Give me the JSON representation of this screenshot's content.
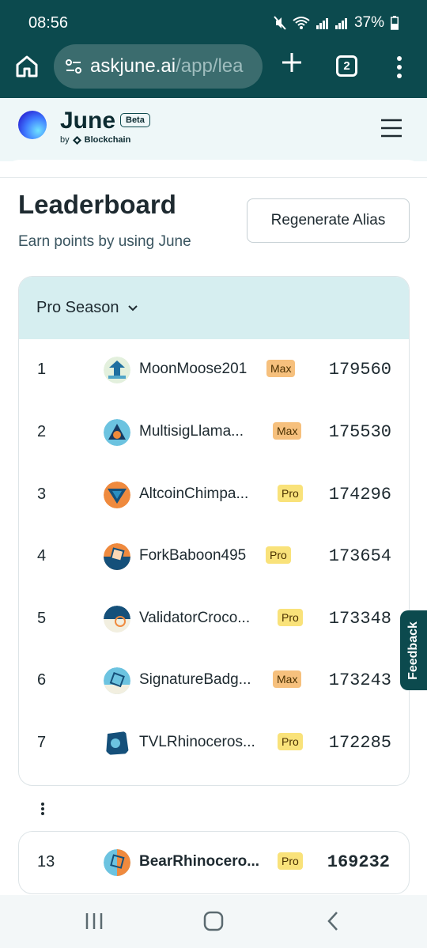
{
  "status_bar": {
    "time": "08:56",
    "battery": "37%"
  },
  "browser": {
    "url_host": "askjune.ai",
    "url_path": "/app/lea",
    "tab_count": "2"
  },
  "brand": {
    "name": "June",
    "badge": "Beta",
    "by_prefix": "by",
    "by_company": "Blockchain"
  },
  "page": {
    "title": "Leaderboard",
    "subtitle": "Earn points by using June",
    "regenerate_label": "Regenerate Alias",
    "season_label": "Pro Season"
  },
  "leaderboard": [
    {
      "rank": "1",
      "name": "MoonMoose201",
      "tier": "Max",
      "score": "179560"
    },
    {
      "rank": "2",
      "name": "MultisigLlama...",
      "tier": "Max",
      "score": "175530"
    },
    {
      "rank": "3",
      "name": "AltcoinChimpa...",
      "tier": "Pro",
      "score": "174296"
    },
    {
      "rank": "4",
      "name": "ForkBaboon495",
      "tier": "Pro",
      "score": "173654"
    },
    {
      "rank": "5",
      "name": "ValidatorCroco...",
      "tier": "Pro",
      "score": "173348"
    },
    {
      "rank": "6",
      "name": "SignatureBadg...",
      "tier": "Max",
      "score": "173243"
    },
    {
      "rank": "7",
      "name": "TVLRhinoceros...",
      "tier": "Pro",
      "score": "172285"
    }
  ],
  "my_entry": {
    "rank": "13",
    "name": "BearRhinocero...",
    "tier": "Pro",
    "score": "169232"
  },
  "feedback_label": "Feedback",
  "colors": {
    "brand_dark": "#0c4a4e",
    "header_bg": "#d6eef0",
    "max_badge": "#f6c07d",
    "pro_badge": "#f9e27a"
  }
}
